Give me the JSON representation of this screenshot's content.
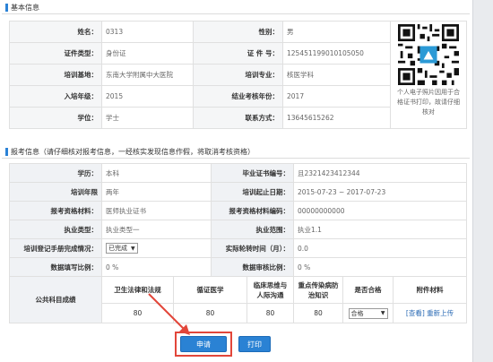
{
  "basic": {
    "title": "基本信息",
    "rows": [
      [
        {
          "label": "姓名：",
          "value": "0313"
        },
        {
          "label": "性别：",
          "value": "男"
        }
      ],
      [
        {
          "label": "证件类型：",
          "value": "身份证"
        },
        {
          "label": "证 件 号：",
          "value": "125451199010105050"
        }
      ],
      [
        {
          "label": "培训基地：",
          "value": "东南大学附属中大医院"
        },
        {
          "label": "培训专业：",
          "value": "核医学科"
        }
      ],
      [
        {
          "label": "入培年级：",
          "value": "2015"
        },
        {
          "label": "结业考核年份：",
          "value": "2017"
        }
      ],
      [
        {
          "label": "学位：",
          "value": "学士"
        },
        {
          "label": "联系方式：",
          "value": "13645615262"
        }
      ]
    ],
    "qr_caption": "个人电子照片因用于合格证书打印，故请仔细核对"
  },
  "apply": {
    "title": "报考信息（请仔细核对报考信息，一经核实发现信息作假，将取消考核资格）",
    "rows": [
      [
        {
          "label": "学历：",
          "value": "本科"
        },
        {
          "label": "毕业证书编号：",
          "value": "且2321423412344"
        }
      ],
      [
        {
          "label": "培训年限",
          "value": "两年"
        },
        {
          "label": "培训起止日期：",
          "value": "2015-07-23 ~ 2017-07-23"
        }
      ],
      [
        {
          "label": "报考资格材料：",
          "value": "医师执业证书"
        },
        {
          "label": "报考资格材料编码：",
          "value": "00000000000"
        }
      ],
      [
        {
          "label": "执业类型：",
          "value": "执业类型一"
        },
        {
          "label": "执业范围：",
          "value": "执业1.1"
        }
      ],
      [
        {
          "label": "培训登记手册完成情况：",
          "value": "已完成"
        },
        {
          "label": "实际轮转时间（月）：",
          "value": "0.0"
        }
      ],
      [
        {
          "label": "数据填写比例：",
          "value": "0 %"
        },
        {
          "label": "数据审核比例：",
          "value": "0 %"
        }
      ]
    ],
    "exam": {
      "row_label": "公共科目成绩",
      "headers": [
        "卫生法律和法规",
        "循证医学",
        "临床思维与人际沟通",
        "重点传染病防治知识",
        "是否合格",
        "附件材料"
      ],
      "scores": [
        "80",
        "80",
        "80",
        "80"
      ],
      "qualified": "合格",
      "view_link": "[查看]",
      "reupload_link": "重新上传"
    }
  },
  "buttons": {
    "apply": "申请",
    "print": "打印"
  },
  "colors": {
    "accent": "#2a82d4",
    "highlight": "#e2463a"
  }
}
